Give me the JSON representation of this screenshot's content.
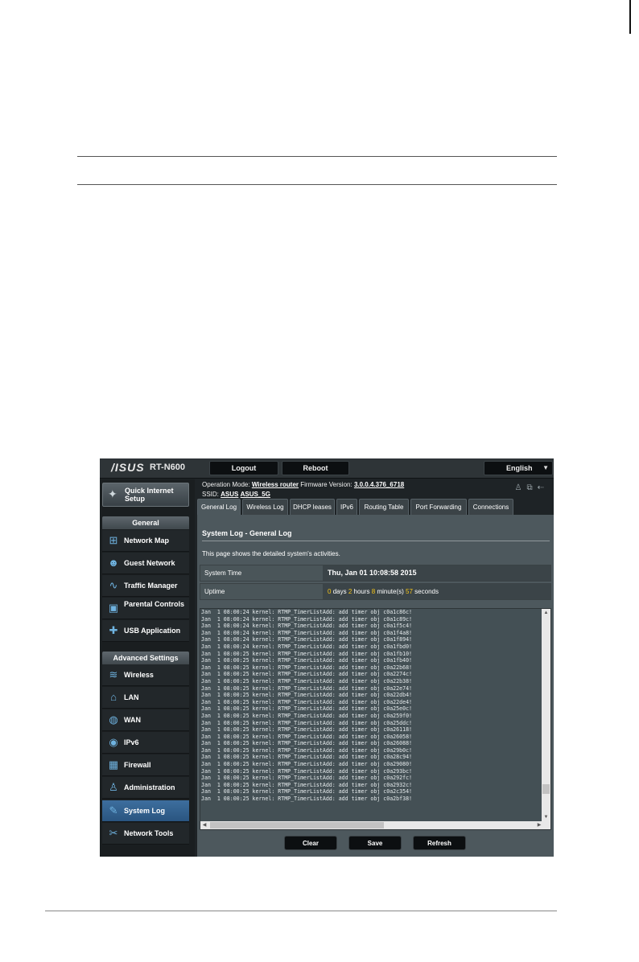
{
  "app": {
    "brand": "/ISUS",
    "model": "RT-N600",
    "logout_label": "Logout",
    "reboot_label": "Reboot",
    "language": "English"
  },
  "status": {
    "operation_mode_label": "Operation Mode:",
    "operation_mode": "Wireless router",
    "firmware_label": "Firmware Version:",
    "firmware": "3.0.0.4.376_6718",
    "ssid_label": "SSID:",
    "ssid_1": "ASUS",
    "ssid_2": "ASUS_5G"
  },
  "sidebar": {
    "quick_setup": "Quick Internet Setup",
    "general_header": "General",
    "general_items": [
      {
        "label": "Network Map",
        "icon": "network-map-icon"
      },
      {
        "label": "Guest Network",
        "icon": "guest-network-icon"
      },
      {
        "label": "Traffic Manager",
        "icon": "traffic-manager-icon"
      },
      {
        "label": "Parental Controls",
        "icon": "lock-icon"
      },
      {
        "label": "USB Application",
        "icon": "puzzle-icon"
      }
    ],
    "advanced_header": "Advanced Settings",
    "advanced_items": [
      {
        "label": "Wireless",
        "icon": "wifi-icon"
      },
      {
        "label": "LAN",
        "icon": "home-icon"
      },
      {
        "label": "WAN",
        "icon": "globe-icon"
      },
      {
        "label": "IPv6",
        "icon": "ipv6-icon"
      },
      {
        "label": "Firewall",
        "icon": "firewall-icon"
      },
      {
        "label": "Administration",
        "icon": "user-icon"
      },
      {
        "label": "System Log",
        "icon": "log-icon"
      },
      {
        "label": "Network Tools",
        "icon": "tools-icon"
      }
    ]
  },
  "tabs": [
    "General Log",
    "Wireless Log",
    "DHCP leases",
    "IPv6",
    "Routing Table",
    "Port Forwarding",
    "Connections"
  ],
  "panel": {
    "title": "System Log - General Log",
    "description": "This page shows the detailed system's activities.",
    "system_time_label": "System Time",
    "system_time": "Thu, Jan 01 10:08:58 2015",
    "uptime_label": "Uptime",
    "uptime_days": "0",
    "uptime_days_label": "days",
    "uptime_hours": "2",
    "uptime_hours_label": "hours",
    "uptime_minutes": "8",
    "uptime_minutes_label": "minute(s)",
    "uptime_seconds": "57",
    "uptime_seconds_label": "seconds"
  },
  "log_lines": [
    "Jan  1 08:00:24 kernel: RTMP_TimerListAdd: add timer obj c0a1c86c!",
    "Jan  1 08:00:24 kernel: RTMP_TimerListAdd: add timer obj c0a1c89c!",
    "Jan  1 08:00:24 kernel: RTMP_TimerListAdd: add timer obj c0a1f5c4!",
    "Jan  1 08:00:24 kernel: RTMP_TimerListAdd: add timer obj c0a1f4a8!",
    "Jan  1 08:00:24 kernel: RTMP_TimerListAdd: add timer obj c0a1f894!",
    "Jan  1 08:00:24 kernel: RTMP_TimerListAdd: add timer obj c0a1fbd0!",
    "Jan  1 08:00:25 kernel: RTMP_TimerListAdd: add timer obj c0a1fb10!",
    "Jan  1 08:00:25 kernel: RTMP_TimerListAdd: add timer obj c0a1fb40!",
    "Jan  1 08:00:25 kernel: RTMP_TimerListAdd: add timer obj c0a22b68!",
    "Jan  1 08:00:25 kernel: RTMP_TimerListAdd: add timer obj c0a2274c!",
    "Jan  1 08:00:25 kernel: RTMP_TimerListAdd: add timer obj c0a22b38!",
    "Jan  1 08:00:25 kernel: RTMP_TimerListAdd: add timer obj c0a22e74!",
    "Jan  1 08:00:25 kernel: RTMP_TimerListAdd: add timer obj c0a22db4!",
    "Jan  1 08:00:25 kernel: RTMP_TimerListAdd: add timer obj c0a22de4!",
    "Jan  1 08:00:25 kernel: RTMP_TimerListAdd: add timer obj c0a25e0c!",
    "Jan  1 08:00:25 kernel: RTMP_TimerListAdd: add timer obj c0a259f0!",
    "Jan  1 08:00:25 kernel: RTMP_TimerListAdd: add timer obj c0a25ddc!",
    "Jan  1 08:00:25 kernel: RTMP_TimerListAdd: add timer obj c0a26118!",
    "Jan  1 08:00:25 kernel: RTMP_TimerListAdd: add timer obj c0a26058!",
    "Jan  1 08:00:25 kernel: RTMP_TimerListAdd: add timer obj c0a26088!",
    "Jan  1 08:00:25 kernel: RTMP_TimerListAdd: add timer obj c0a29b0c!",
    "Jan  1 08:00:25 kernel: RTMP_TimerListAdd: add timer obj c0a28c94!",
    "Jan  1 08:00:25 kernel: RTMP_TimerListAdd: add timer obj c0a29080!",
    "Jan  1 08:00:25 kernel: RTMP_TimerListAdd: add timer obj c0a293bc!",
    "Jan  1 08:00:25 kernel: RTMP_TimerListAdd: add timer obj c0a292fc!",
    "Jan  1 08:00:25 kernel: RTMP_TimerListAdd: add timer obj c0a2932c!",
    "Jan  1 08:00:25 kernel: RTMP_TimerListAdd: add timer obj c0a2c354!",
    "Jan  1 08:00:25 kernel: RTMP_TimerListAdd: add timer obj c0a2bf38!"
  ],
  "buttons": {
    "clear": "Clear",
    "save": "Save",
    "refresh": "Refresh"
  }
}
